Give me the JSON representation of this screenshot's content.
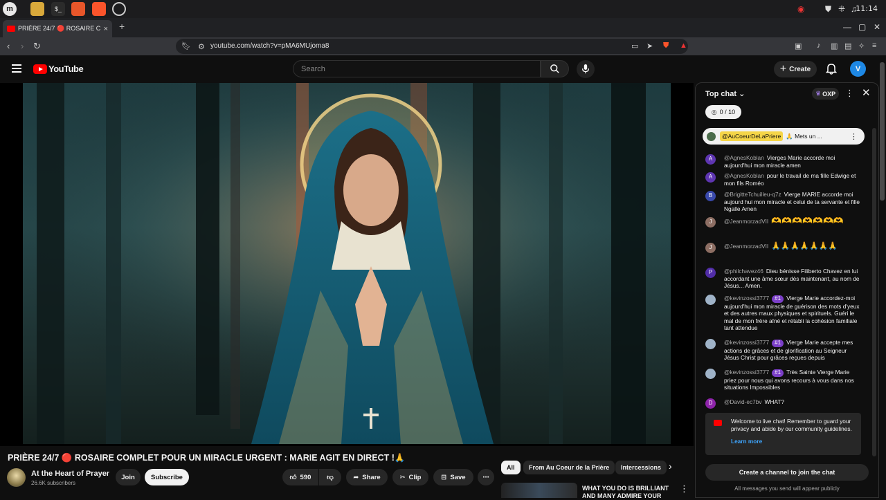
{
  "os": {
    "clock": "11:14"
  },
  "browser": {
    "tab_title": "PRIÈRE 24/7 🔴 ROSAIRE C",
    "url": "youtube.com/watch?v=pMA6MUjoma8",
    "new_tab": "+",
    "tab_close": "×",
    "window_buttons": [
      "—",
      "▢",
      "✕"
    ]
  },
  "header": {
    "logo_text": "YouTube",
    "search_placeholder": "Search",
    "create_label": "Create",
    "create_plus": "+",
    "avatar_letter": "V"
  },
  "video": {
    "title": "PRIÈRE 24/7 🔴 ROSAIRE COMPLET POUR UN MIRACLE URGENT : MARIE AGIT EN DIRECT !🙏",
    "channel_name": "At the Heart of Prayer",
    "subscribers": "26.6K subscribers",
    "join_label": "Join",
    "subscribe_label": "Subscribe",
    "like_count": "590",
    "share_label": "Share",
    "clip_label": "Clip",
    "save_label": "Save",
    "more": "⋯"
  },
  "chips": [
    "All",
    "From Au Coeur de la Prière",
    "Intercessions"
  ],
  "recommendation": {
    "title": "WHAT YOU DO IS BRILLIANT AND MANY ADMIRE YOUR"
  },
  "chat": {
    "header": "Top chat",
    "oxp_label": "OXP",
    "goal": "0 / 10",
    "pinned_user": "@AuCoeurDeLaPriere",
    "pinned_text": "🙏 Mets un ...",
    "messages": [
      {
        "initial": "A",
        "color": "#5e35b1",
        "user": "@AgnesKoblan",
        "text": "Vierges Marie accorde moi aujourd'hui mon miracle amen"
      },
      {
        "initial": "A",
        "color": "#5e35b1",
        "user": "@AgnesKoblan",
        "text": "pour le travail de ma fille Edwige et mon fils Roméo"
      },
      {
        "initial": "B",
        "color": "#3949ab",
        "user": "@BrigitteTchuilleu-q7z",
        "text": "Vierge MARIE accorde moi aujourd hui mon miracle et celui de ta servante et fille Ngalle Amen"
      },
      {
        "initial": "J",
        "color": "#8d6e63",
        "user": "@JeanmorzadVII",
        "text": "🫶🫶🫶🫶🫶🫶🫶"
      },
      {
        "initial": "J",
        "color": "#8d6e63",
        "user": "@JeanmorzadVII",
        "text": "🙏🙏🙏🙏🙏🙏🙏"
      },
      {
        "initial": "P",
        "color": "#512da8",
        "user": "@philchavez46",
        "text": "Dieu bénisse Filiberto Chavez en lui accordant une âme sœur dès maintenant, au nom de Jésus... Amen."
      },
      {
        "initial": "",
        "color": "#9fb3c8",
        "user": "@kevinzossi3777",
        "badge": "#1",
        "text": "Vierge Marie accordez-moi aujourd'hui mon miracle de guérison des mots d'yeux et des autres maux physiques et spirituels. Guéri le mal de mon frère aîné et rétabli la cohésion familiale tant attendue"
      },
      {
        "initial": "",
        "color": "#9fb3c8",
        "user": "@kevinzossi3777",
        "badge": "#1",
        "text": "Vierge Marie accepte mes actions de grâces et de glorification au Seigneur Jésus Christ pour grâces reçues depuis"
      },
      {
        "initial": "",
        "color": "#9fb3c8",
        "user": "@kevinzossi3777",
        "badge": "#1",
        "text": "Très Sainte Vierge Marie priez pour nous qui avons recours à vous dans nos situations Impossibles"
      },
      {
        "initial": "D",
        "color": "#8e24aa",
        "user": "@David-ec7bv",
        "text": "WHAT?"
      }
    ],
    "welcome_text": "Welcome to live chat! Remember to guard your privacy and abide by our community guidelines.",
    "learn_more": "Learn more",
    "join_chat_label": "Create a channel to join the chat",
    "public_note": "All messages you send will appear publicly"
  }
}
